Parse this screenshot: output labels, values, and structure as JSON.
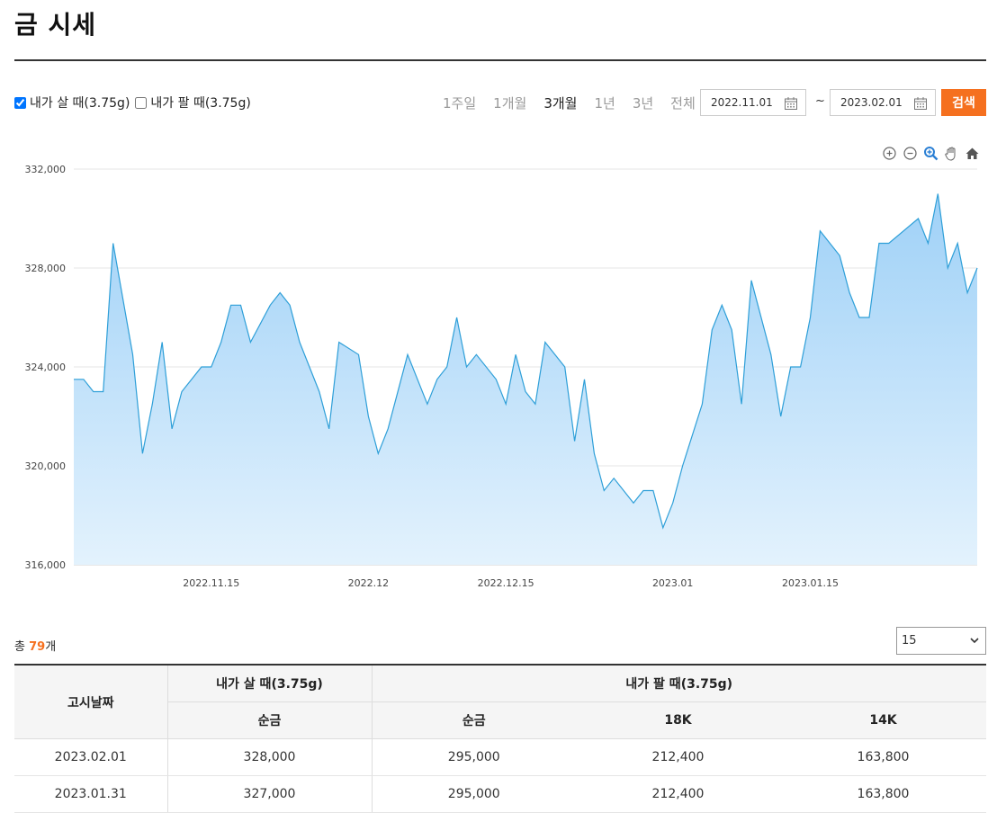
{
  "page": {
    "title": "금 시세"
  },
  "options": {
    "buy_label": "내가 살 때(3.75g)",
    "buy_checked": true,
    "sell_label": "내가 팔 때(3.75g)",
    "sell_checked": false
  },
  "periods": [
    {
      "label": "1주일",
      "active": false
    },
    {
      "label": "1개월",
      "active": false
    },
    {
      "label": "3개월",
      "active": true
    },
    {
      "label": "1년",
      "active": false
    },
    {
      "label": "3년",
      "active": false
    },
    {
      "label": "전체",
      "active": false
    }
  ],
  "date_range": {
    "from": "2022.11.01",
    "to": "2023.02.01",
    "separator": "~"
  },
  "search_label": "검색",
  "chart_tools": [
    "zoom-in-icon",
    "zoom-out-icon",
    "zoom-select-icon",
    "pan-hand-icon",
    "home-reset-icon"
  ],
  "chart_data": {
    "type": "area",
    "ylim": [
      316000,
      332000
    ],
    "y_ticks": [
      "316,000",
      "320,000",
      "324,000",
      "328,000",
      "332,000"
    ],
    "y_tick_values": [
      316000,
      320000,
      324000,
      328000,
      332000
    ],
    "x_ticks": [
      {
        "label": "2022.11.15",
        "date": "2022-11-15"
      },
      {
        "label": "2022.12",
        "date": "2022-12-01"
      },
      {
        "label": "2022.12.15",
        "date": "2022-12-15"
      },
      {
        "label": "2023.01",
        "date": "2023-01-01"
      },
      {
        "label": "2023.01.15",
        "date": "2023-01-15"
      }
    ],
    "grid": true,
    "line_color": "#2e9fd8",
    "fill_top_color": "#9fd1f7",
    "fill_bottom_color": "#e3f2fd",
    "series": [
      {
        "points": [
          [
            "2022-11-01",
            323500
          ],
          [
            "2022-11-02",
            323500
          ],
          [
            "2022-11-03",
            323000
          ],
          [
            "2022-11-04",
            323000
          ],
          [
            "2022-11-05",
            329000
          ],
          [
            "2022-11-07",
            324500
          ],
          [
            "2022-11-08",
            320500
          ],
          [
            "2022-11-09",
            322500
          ],
          [
            "2022-11-10",
            325000
          ],
          [
            "2022-11-11",
            321500
          ],
          [
            "2022-11-12",
            323000
          ],
          [
            "2022-11-14",
            324000
          ],
          [
            "2022-11-15",
            324000
          ],
          [
            "2022-11-16",
            325000
          ],
          [
            "2022-11-17",
            326500
          ],
          [
            "2022-11-18",
            326500
          ],
          [
            "2022-11-19",
            325000
          ],
          [
            "2022-11-21",
            326500
          ],
          [
            "2022-11-22",
            327000
          ],
          [
            "2022-11-23",
            326500
          ],
          [
            "2022-11-24",
            325000
          ],
          [
            "2022-11-26",
            323000
          ],
          [
            "2022-11-27",
            321500
          ],
          [
            "2022-11-28",
            325000
          ],
          [
            "2022-11-30",
            324500
          ],
          [
            "2022-12-01",
            322000
          ],
          [
            "2022-12-02",
            320500
          ],
          [
            "2022-12-03",
            321500
          ],
          [
            "2022-12-05",
            324500
          ],
          [
            "2022-12-07",
            322500
          ],
          [
            "2022-12-08",
            323500
          ],
          [
            "2022-12-09",
            324000
          ],
          [
            "2022-12-10",
            326000
          ],
          [
            "2022-12-11",
            324000
          ],
          [
            "2022-12-12",
            324500
          ],
          [
            "2022-12-14",
            323500
          ],
          [
            "2022-12-15",
            322500
          ],
          [
            "2022-12-16",
            324500
          ],
          [
            "2022-12-17",
            323000
          ],
          [
            "2022-12-18",
            322500
          ],
          [
            "2022-12-19",
            325000
          ],
          [
            "2022-12-21",
            324000
          ],
          [
            "2022-12-22",
            321000
          ],
          [
            "2022-12-23",
            323500
          ],
          [
            "2022-12-24",
            320500
          ],
          [
            "2022-12-25",
            319000
          ],
          [
            "2022-12-26",
            319500
          ],
          [
            "2022-12-28",
            318500
          ],
          [
            "2022-12-29",
            319000
          ],
          [
            "2022-12-30",
            319000
          ],
          [
            "2022-12-31",
            317500
          ],
          [
            "2023-01-01",
            318500
          ],
          [
            "2023-01-02",
            320000
          ],
          [
            "2023-01-04",
            322500
          ],
          [
            "2023-01-05",
            325500
          ],
          [
            "2023-01-06",
            326500
          ],
          [
            "2023-01-07",
            325500
          ],
          [
            "2023-01-08",
            322500
          ],
          [
            "2023-01-09",
            327500
          ],
          [
            "2023-01-11",
            324500
          ],
          [
            "2023-01-12",
            322000
          ],
          [
            "2023-01-13",
            324000
          ],
          [
            "2023-01-14",
            324000
          ],
          [
            "2023-01-15",
            326000
          ],
          [
            "2023-01-16",
            329500
          ],
          [
            "2023-01-18",
            328500
          ],
          [
            "2023-01-19",
            327000
          ],
          [
            "2023-01-20",
            326000
          ],
          [
            "2023-01-21",
            326000
          ],
          [
            "2023-01-22",
            329000
          ],
          [
            "2023-01-23",
            329000
          ],
          [
            "2023-01-26",
            330000
          ],
          [
            "2023-01-27",
            329000
          ],
          [
            "2023-01-28",
            331000
          ],
          [
            "2023-01-29",
            328000
          ],
          [
            "2023-01-30",
            329000
          ],
          [
            "2023-01-31",
            327000
          ],
          [
            "2023-02-01",
            328000
          ]
        ]
      }
    ]
  },
  "list": {
    "count_prefix": "총 ",
    "count": "79",
    "count_suffix": "개",
    "page_size": "15"
  },
  "table": {
    "date_header": "고시날짜",
    "buy_group": "내가 살 때(3.75g)",
    "sell_group": "내가 팔 때(3.75g)",
    "sub_headers": [
      "순금",
      "순금",
      "18K",
      "14K"
    ],
    "rows": [
      [
        "2023.02.01",
        "328,000",
        "295,000",
        "212,400",
        "163,800"
      ],
      [
        "2023.01.31",
        "327,000",
        "295,000",
        "212,400",
        "163,800"
      ]
    ]
  }
}
